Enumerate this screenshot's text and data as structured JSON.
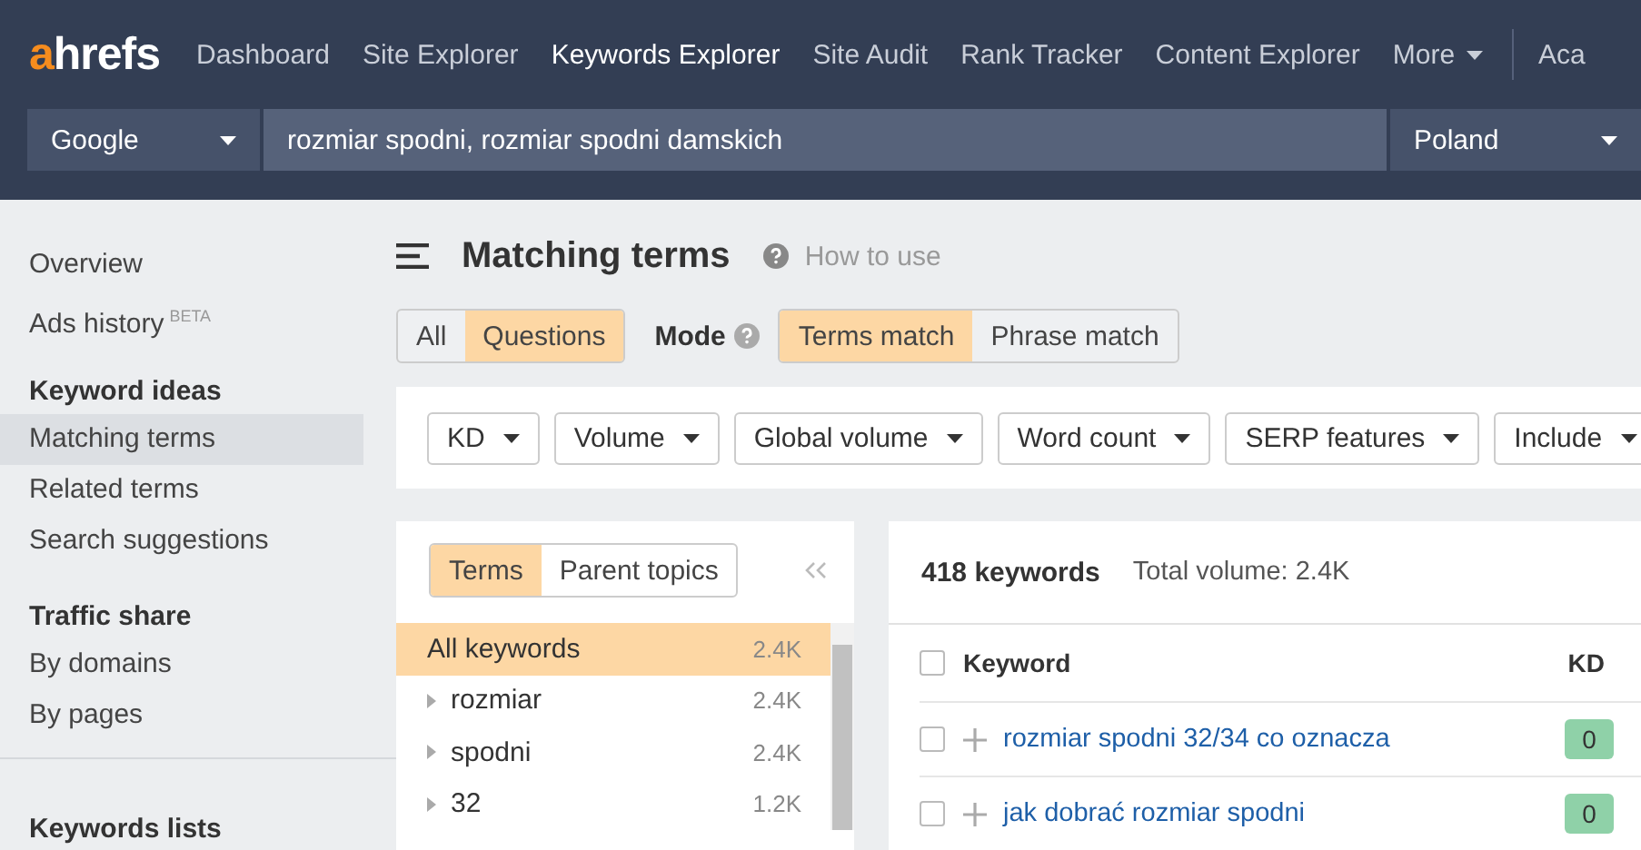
{
  "logo": "ahrefs",
  "nav": [
    {
      "label": "Dashboard",
      "selected": false,
      "kind": "link"
    },
    {
      "label": "Site Explorer",
      "selected": false,
      "kind": "link"
    },
    {
      "label": "Keywords Explorer",
      "selected": true,
      "kind": "link"
    },
    {
      "label": "Site Audit",
      "selected": false,
      "kind": "link"
    },
    {
      "label": "Rank Tracker",
      "selected": false,
      "kind": "link"
    },
    {
      "label": "Content Explorer",
      "selected": false,
      "kind": "link"
    },
    {
      "label": "More",
      "selected": false,
      "kind": "menu"
    },
    {
      "label": "Aca",
      "selected": false,
      "kind": "link"
    }
  ],
  "search": {
    "engine": "Google",
    "query": "rozmiar spodni, rozmiar spodni damskich",
    "country": "Poland"
  },
  "sidebar": [
    {
      "items": [
        {
          "label": "Overview",
          "selected": false
        },
        {
          "label": "Ads history",
          "badge": "BETA",
          "selected": false
        }
      ]
    },
    {
      "heading": "Keyword ideas",
      "items": [
        {
          "label": "Matching terms",
          "selected": true
        },
        {
          "label": "Related terms",
          "selected": false
        },
        {
          "label": "Search suggestions",
          "selected": false
        }
      ]
    },
    {
      "heading": "Traffic share",
      "items": [
        {
          "label": "By domains",
          "selected": false
        },
        {
          "label": "By pages",
          "selected": false
        }
      ]
    },
    {
      "heading": "Keywords lists"
    }
  ],
  "title": "Matching terms",
  "help_link": "How to use",
  "type_tabs": [
    {
      "label": "All",
      "selected": false
    },
    {
      "label": "Questions",
      "selected": true
    }
  ],
  "mode_label": "Mode",
  "mode_tabs": [
    {
      "label": "Terms match",
      "selected": true
    },
    {
      "label": "Phrase match",
      "selected": false
    }
  ],
  "filters": [
    "KD",
    "Volume",
    "Global volume",
    "Word count",
    "SERP features",
    "Include"
  ],
  "terms_panel": {
    "tabs": [
      {
        "label": "Terms",
        "selected": true
      },
      {
        "label": "Parent topics",
        "selected": false
      }
    ],
    "rows": [
      {
        "kind": "all",
        "label": "All keywords",
        "value": "2.4K",
        "selected": true
      },
      {
        "kind": "term",
        "label": "rozmiar",
        "value": "2.4K",
        "selected": false
      },
      {
        "kind": "term",
        "label": "spodni",
        "value": "2.4K",
        "selected": false
      },
      {
        "kind": "term",
        "label": "32",
        "value": "1.2K",
        "selected": false
      }
    ]
  },
  "results": {
    "count": "418 keywords",
    "total": "Total volume: 2.4K",
    "columns": [
      "Keyword",
      "KD"
    ],
    "select_all_checked": false,
    "rows": [
      {
        "keyword": "rozmiar spodni 32/34 co oznacza",
        "kd": "0",
        "checked": false
      },
      {
        "keyword": "jak dobrać rozmiar spodni",
        "kd": "0",
        "checked": false
      }
    ]
  }
}
